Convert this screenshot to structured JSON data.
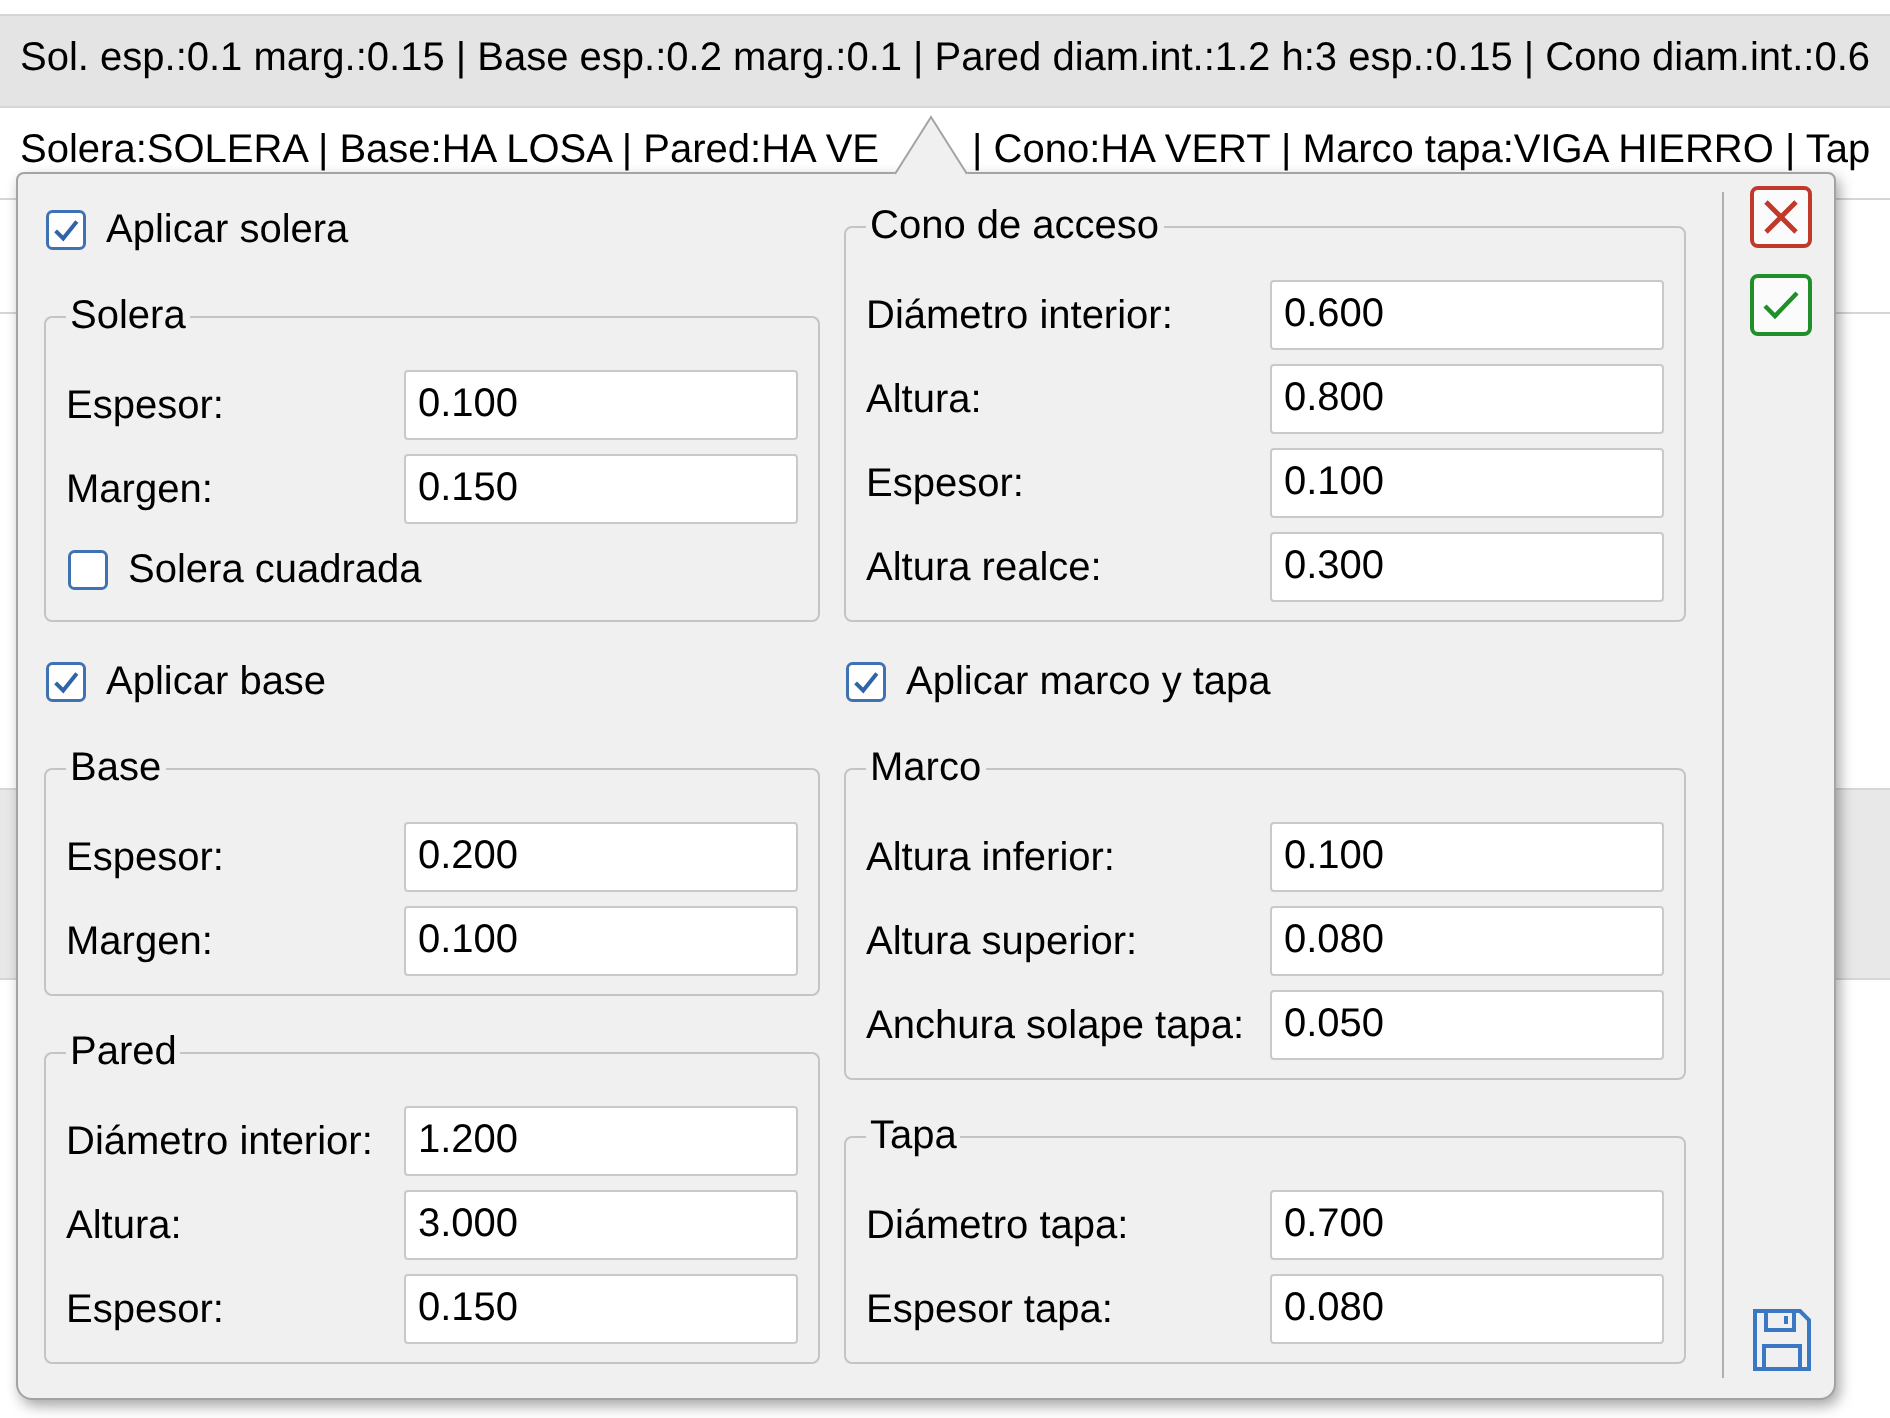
{
  "table": {
    "rows": [
      {
        "cells": [
          "Sol. esp.:0.1 marg.:0.15 | Base esp.:0.2 marg.:0.1 | Pared diam.int.:1.2 h:3 esp.:0.15 | Cono diam.int.:0.6"
        ],
        "selected": true
      },
      {
        "cells": [
          "Solera:SOLERA | Base:HA LOSA | Pared:HA VE",
          "| Cono:HA VERT | Marco tapa:VIGA HIERRO | Tap"
        ],
        "selected": false
      }
    ]
  },
  "popup": {
    "columns": [
      {
        "items": [
          {
            "kind": "checkbox",
            "label": "Aplicar solera",
            "checked": true
          },
          {
            "kind": "group",
            "title": "Solera",
            "items": [
              {
                "kind": "field",
                "label": "Espesor:",
                "value": "0.100"
              },
              {
                "kind": "field",
                "label": "Margen:",
                "value": "0.150"
              },
              {
                "kind": "checkbox",
                "label": "Solera cuadrada",
                "checked": false
              }
            ]
          },
          {
            "kind": "checkbox",
            "label": "Aplicar base",
            "checked": true
          },
          {
            "kind": "group",
            "title": "Base",
            "items": [
              {
                "kind": "field",
                "label": "Espesor:",
                "value": "0.200"
              },
              {
                "kind": "field",
                "label": "Margen:",
                "value": "0.100"
              }
            ]
          },
          {
            "kind": "group",
            "title": "Pared",
            "items": [
              {
                "kind": "field",
                "label": "Diámetro interior:",
                "value": "1.200"
              },
              {
                "kind": "field",
                "label": "Altura:",
                "value": "3.000"
              },
              {
                "kind": "field",
                "label": "Espesor:",
                "value": "0.150"
              }
            ]
          }
        ]
      },
      {
        "items": [
          {
            "kind": "group",
            "title": "Cono de acceso",
            "items": [
              {
                "kind": "field",
                "label": "Diámetro interior:",
                "value": "0.600"
              },
              {
                "kind": "field",
                "label": "Altura:",
                "value": "0.800"
              },
              {
                "kind": "field",
                "label": "Espesor:",
                "value": "0.100"
              },
              {
                "kind": "field",
                "label": "Altura realce:",
                "value": "0.300"
              }
            ]
          },
          {
            "kind": "checkbox",
            "label": "Aplicar marco y tapa",
            "checked": true
          },
          {
            "kind": "group",
            "title": "Marco",
            "items": [
              {
                "kind": "field",
                "label": "Altura inferior:",
                "value": "0.100"
              },
              {
                "kind": "field",
                "label": "Altura superior:",
                "value": "0.080"
              },
              {
                "kind": "field",
                "label": "Anchura solape tapa:",
                "value": "0.050"
              }
            ]
          },
          {
            "kind": "group",
            "title": "Tapa",
            "items": [
              {
                "kind": "field",
                "label": "Diámetro tapa:",
                "value": "0.700"
              },
              {
                "kind": "field",
                "label": "Espesor tapa:",
                "value": "0.080"
              }
            ]
          }
        ]
      }
    ]
  }
}
